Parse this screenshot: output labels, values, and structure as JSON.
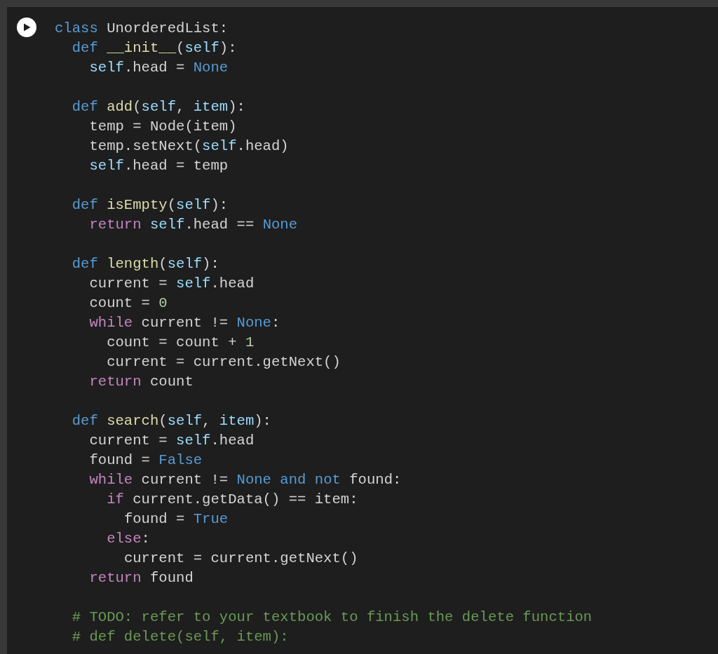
{
  "cell": {
    "run_button": {
      "kind": "play"
    },
    "code": [
      {
        "kind": "code",
        "tokens": [
          {
            "text": "class",
            "kind": "kw"
          },
          {
            "text": " UnorderedList:",
            "kind": "txt"
          }
        ],
        "children": [
          {
            "kind": "code",
            "tokens": [
              {
                "text": "def ",
                "kind": "kw"
              },
              {
                "text": "__init__",
                "kind": "fn"
              },
              {
                "text": "(",
                "kind": "txt"
              },
              {
                "text": "self",
                "kind": "var"
              },
              {
                "text": "):",
                "kind": "txt"
              }
            ],
            "children": [
              {
                "kind": "code",
                "tokens": [
                  {
                    "text": "self",
                    "kind": "var"
                  },
                  {
                    "text": ".head = ",
                    "kind": "txt"
                  },
                  {
                    "text": "None",
                    "kind": "kw"
                  }
                ]
              }
            ]
          },
          {
            "kind": "blank"
          },
          {
            "kind": "code",
            "tokens": [
              {
                "text": "def ",
                "kind": "kw"
              },
              {
                "text": "add",
                "kind": "fn"
              },
              {
                "text": "(",
                "kind": "txt"
              },
              {
                "text": "self",
                "kind": "var"
              },
              {
                "text": ", ",
                "kind": "txt"
              },
              {
                "text": "item",
                "kind": "var"
              },
              {
                "text": "):",
                "kind": "txt"
              }
            ],
            "children": [
              {
                "kind": "code",
                "tokens": [
                  {
                    "text": "temp = Node(item)",
                    "kind": "txt"
                  }
                ]
              },
              {
                "kind": "code",
                "tokens": [
                  {
                    "text": "temp.setNext(",
                    "kind": "txt"
                  },
                  {
                    "text": "self",
                    "kind": "var"
                  },
                  {
                    "text": ".head)",
                    "kind": "txt"
                  }
                ]
              },
              {
                "kind": "code",
                "tokens": [
                  {
                    "text": "self",
                    "kind": "var"
                  },
                  {
                    "text": ".head = temp",
                    "kind": "txt"
                  }
                ]
              }
            ]
          },
          {
            "kind": "blank"
          },
          {
            "kind": "code",
            "tokens": [
              {
                "text": "def ",
                "kind": "kw"
              },
              {
                "text": "isEmpty",
                "kind": "fn"
              },
              {
                "text": "(",
                "kind": "txt"
              },
              {
                "text": "self",
                "kind": "var"
              },
              {
                "text": "):",
                "kind": "txt"
              }
            ],
            "children": [
              {
                "kind": "code",
                "tokens": [
                  {
                    "text": "return ",
                    "kind": "ctl"
                  },
                  {
                    "text": "self",
                    "kind": "var"
                  },
                  {
                    "text": ".head == ",
                    "kind": "txt"
                  },
                  {
                    "text": "None",
                    "kind": "kw"
                  }
                ]
              }
            ]
          },
          {
            "kind": "blank"
          },
          {
            "kind": "code",
            "tokens": [
              {
                "text": "def ",
                "kind": "kw"
              },
              {
                "text": "length",
                "kind": "fn"
              },
              {
                "text": "(",
                "kind": "txt"
              },
              {
                "text": "self",
                "kind": "var"
              },
              {
                "text": "):",
                "kind": "txt"
              }
            ],
            "children": [
              {
                "kind": "code",
                "tokens": [
                  {
                    "text": "current = ",
                    "kind": "txt"
                  },
                  {
                    "text": "self",
                    "kind": "var"
                  },
                  {
                    "text": ".head",
                    "kind": "txt"
                  }
                ]
              },
              {
                "kind": "code",
                "tokens": [
                  {
                    "text": "count = ",
                    "kind": "txt"
                  },
                  {
                    "text": "0",
                    "kind": "num"
                  }
                ]
              },
              {
                "kind": "code",
                "tokens": [
                  {
                    "text": "while",
                    "kind": "ctl"
                  },
                  {
                    "text": " current != ",
                    "kind": "txt"
                  },
                  {
                    "text": "None",
                    "kind": "kw"
                  },
                  {
                    "text": ":",
                    "kind": "txt"
                  }
                ],
                "children": [
                  {
                    "kind": "code",
                    "tokens": [
                      {
                        "text": "count = count + ",
                        "kind": "txt"
                      },
                      {
                        "text": "1",
                        "kind": "num"
                      }
                    ]
                  },
                  {
                    "kind": "code",
                    "tokens": [
                      {
                        "text": "current = current.getNext()",
                        "kind": "txt"
                      }
                    ]
                  }
                ]
              },
              {
                "kind": "code",
                "tokens": [
                  {
                    "text": "return",
                    "kind": "ctl"
                  },
                  {
                    "text": " count",
                    "kind": "txt"
                  }
                ]
              }
            ]
          },
          {
            "kind": "blank"
          },
          {
            "kind": "code",
            "tokens": [
              {
                "text": "def ",
                "kind": "kw"
              },
              {
                "text": "search",
                "kind": "fn"
              },
              {
                "text": "(",
                "kind": "txt"
              },
              {
                "text": "self",
                "kind": "var"
              },
              {
                "text": ", ",
                "kind": "txt"
              },
              {
                "text": "item",
                "kind": "var"
              },
              {
                "text": "):",
                "kind": "txt"
              }
            ],
            "children": [
              {
                "kind": "code",
                "tokens": [
                  {
                    "text": "current = ",
                    "kind": "txt"
                  },
                  {
                    "text": "self",
                    "kind": "var"
                  },
                  {
                    "text": ".head",
                    "kind": "txt"
                  }
                ]
              },
              {
                "kind": "code",
                "tokens": [
                  {
                    "text": "found = ",
                    "kind": "txt"
                  },
                  {
                    "text": "False",
                    "kind": "kw"
                  }
                ]
              },
              {
                "kind": "code",
                "tokens": [
                  {
                    "text": "while",
                    "kind": "ctl"
                  },
                  {
                    "text": " current != ",
                    "kind": "txt"
                  },
                  {
                    "text": "None and not",
                    "kind": "kw"
                  },
                  {
                    "text": " found:",
                    "kind": "txt"
                  }
                ],
                "children": [
                  {
                    "kind": "code",
                    "tokens": [
                      {
                        "text": "if",
                        "kind": "ctl"
                      },
                      {
                        "text": " current.getData() == item:",
                        "kind": "txt"
                      }
                    ],
                    "children": [
                      {
                        "kind": "code",
                        "tokens": [
                          {
                            "text": "found = ",
                            "kind": "txt"
                          },
                          {
                            "text": "True",
                            "kind": "kw"
                          }
                        ]
                      }
                    ]
                  },
                  {
                    "kind": "code",
                    "tokens": [
                      {
                        "text": "else",
                        "kind": "ctl"
                      },
                      {
                        "text": ":",
                        "kind": "txt"
                      }
                    ],
                    "children": [
                      {
                        "kind": "code",
                        "tokens": [
                          {
                            "text": "current = current.getNext()",
                            "kind": "txt"
                          }
                        ]
                      }
                    ]
                  }
                ]
              },
              {
                "kind": "code",
                "tokens": [
                  {
                    "text": "return",
                    "kind": "ctl"
                  },
                  {
                    "text": " found",
                    "kind": "txt"
                  }
                ]
              }
            ]
          },
          {
            "kind": "blank"
          },
          {
            "kind": "code",
            "tokens": [
              {
                "text": "# TODO: refer to your textbook to finish the delete function",
                "kind": "cmt"
              }
            ]
          },
          {
            "kind": "code",
            "tokens": [
              {
                "text": "# def delete(self, item):",
                "kind": "cmt"
              }
            ]
          }
        ]
      }
    ]
  }
}
